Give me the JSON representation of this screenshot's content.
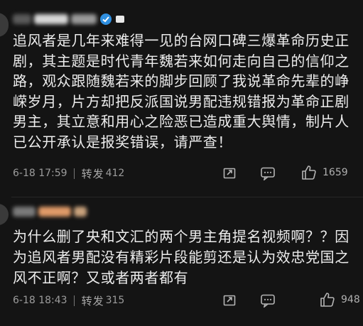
{
  "comments": [
    {
      "text": "追风者是几年来难得一见的台网口碑三爆革命历史正剧，其主题是时代青年魏若来如何走向自己的信仰之路，观众跟随魏若来的脚步回顾了我说革命先辈的峥嵘岁月，片方却把反派国说男配违规错报为革命正剧男主，其立意和用心之险恶已造成重大舆情，制片人已公开承认是报奖错误，请严查！",
      "date": "6-18 17:59",
      "repost_label": "转发",
      "repost_count": "412",
      "likes": "1659"
    },
    {
      "text": "为什么删了央和文汇的两个男主角提名视频啊？？因为追风者男配没有精彩片段能剪还是认为效忠党国之风不正啊？又或者两者都有",
      "date": "6-18 18:43",
      "repost_label": "转发",
      "repost_count": "315",
      "likes": "948"
    }
  ],
  "colors": {
    "background": "#141414",
    "text": "#ececec",
    "meta": "#9c9c9c"
  },
  "icons": [
    "share-icon",
    "comment-icon",
    "like-icon",
    "verified-badge-icon"
  ]
}
